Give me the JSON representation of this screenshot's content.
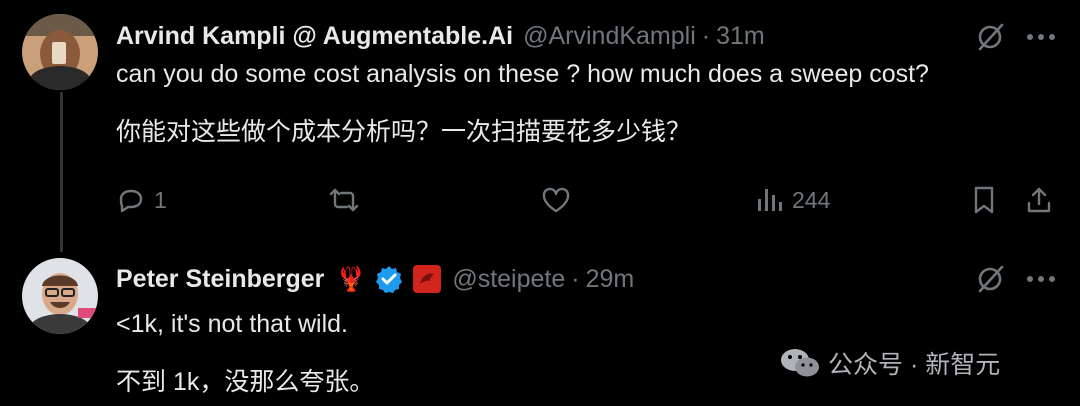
{
  "tweet1": {
    "author_name": "Arvind Kampli @ Augmentable.Ai",
    "handle": "@ArvindKampli",
    "separator": "·",
    "time": "31m",
    "text_en": "can you do some cost analysis on these ? how much does a sweep cost?",
    "text_zh": "你能对这些做个成本分析吗？一次扫描要花多少钱？",
    "actions": {
      "reply_count": "1",
      "retweet_count": "",
      "like_count": "",
      "views_count": "244"
    }
  },
  "tweet2": {
    "author_name": "Peter Steinberger",
    "emoji": "🦞",
    "handle": "@steipete",
    "separator": "·",
    "time": "29m",
    "text_en": "<1k, it's not that wild.",
    "text_zh": "不到 1k，没那么夸张。"
  },
  "watermark": {
    "text": "公众号 · 新智元"
  },
  "colors": {
    "background": "#000000",
    "primary_text": "#e7e9ea",
    "secondary_text": "#71767b",
    "verified_blue": "#1d9bf0",
    "accent_red": "#d0241c"
  },
  "icons": [
    "grok-icon",
    "more-icon",
    "reply-icon",
    "retweet-icon",
    "like-icon",
    "views-icon",
    "bookmark-icon",
    "share-icon",
    "verified-badge-icon",
    "affiliate-badge-icon",
    "wechat-icon"
  ]
}
